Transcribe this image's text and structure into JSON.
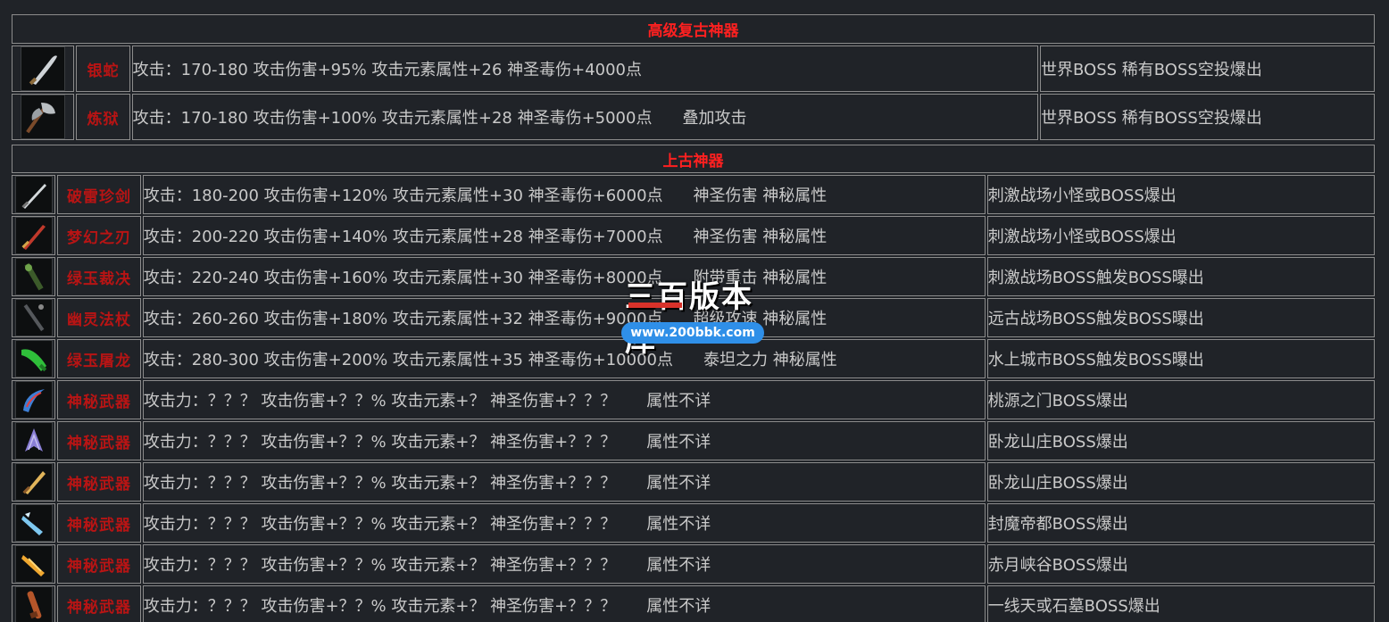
{
  "colors": {
    "background": "#202328",
    "section_title": "#ff2020",
    "item_name": "#b81414",
    "text": "#c9c9c9",
    "cell_border": "#8c8c8c"
  },
  "sections": [
    {
      "title": "高级复古神器",
      "rows": [
        {
          "icon": "curved-blade-icon",
          "name": "银蛇",
          "stats": "攻击：170-180 攻击伤害+95% 攻击元素属性+26 神圣毒伤+4000点",
          "extra": "",
          "source": "世界BOSS 稀有BOSS空投爆出"
        },
        {
          "icon": "battle-axe-icon",
          "name": "炼狱",
          "stats": "攻击：170-180 攻击伤害+100% 攻击元素属性+28 神圣毒伤+5000点",
          "extra": "叠加攻击",
          "source": "世界BOSS 稀有BOSS空投爆出"
        }
      ]
    },
    {
      "title": "上古神器",
      "rows": [
        {
          "icon": "silver-sword-icon",
          "name": "破雷珍剑",
          "stats": "攻击：180-200 攻击伤害+120% 攻击元素属性+30 神圣毒伤+6000点",
          "extra": "神圣伤害  神秘属性",
          "source": "刺激战场小怪或BOSS爆出"
        },
        {
          "icon": "red-sword-icon",
          "name": "梦幻之刃",
          "stats": "攻击：200-220 攻击伤害+140% 攻击元素属性+28 神圣毒伤+7000点",
          "extra": "神圣伤害  神秘属性",
          "source": "刺激战场小怪或BOSS爆出"
        },
        {
          "icon": "jade-staff-icon",
          "name": "绿玉裁决",
          "stats": "攻击：220-240 攻击伤害+160% 攻击元素属性+30 神圣毒伤+8000点",
          "extra": "附带重击  神秘属性",
          "source": "刺激战场BOSS触发BOSS曝出"
        },
        {
          "icon": "dark-staff-icon",
          "name": "幽灵法杖",
          "stats": "攻击：260-260 攻击伤害+180% 攻击元素属性+32 神圣毒伤+9000点",
          "extra": "超级攻速  神秘属性",
          "source": "远古战场BOSS触发BOSS曝出"
        },
        {
          "icon": "jade-dragon-icon",
          "name": "绿玉屠龙",
          "stats": "攻击：280-300 攻击伤害+200% 攻击元素属性+35 神圣毒伤+10000点",
          "extra": "泰坦之力  神秘属性",
          "source": "水上城市BOSS触发BOSS曝出"
        },
        {
          "icon": "hook-blade-icon",
          "name": "神秘武器",
          "stats": "攻击力：？？？ 攻击伤害+？？% 攻击元素+？ 神圣伤害+？？？",
          "extra": "属性不详",
          "source": "桃源之门BOSS爆出"
        },
        {
          "icon": "crystal-blade-icon",
          "name": "神秘武器",
          "stats": "攻击力：？？？ 攻击伤害+？？% 攻击元素+？ 神圣伤害+？？？",
          "extra": "属性不详",
          "source": "卧龙山庄BOSS爆出"
        },
        {
          "icon": "golden-sword-icon",
          "name": "神秘武器",
          "stats": "攻击力：？？？ 攻击伤害+？？% 攻击元素+？ 神圣伤害+？？？",
          "extra": "属性不详",
          "source": "卧龙山庄BOSS爆出"
        },
        {
          "icon": "ice-blade-icon",
          "name": "神秘武器",
          "stats": "攻击力：？？？ 攻击伤害+？？% 攻击元素+？ 神圣伤害+？？？",
          "extra": "属性不详",
          "source": "封魔帝都BOSS爆出"
        },
        {
          "icon": "flame-sword-icon",
          "name": "神秘武器",
          "stats": "攻击力：？？？ 攻击伤害+？？% 攻击元素+？ 神圣伤害+？？？",
          "extra": "属性不详",
          "source": "赤月峡谷BOSS爆出"
        },
        {
          "icon": "bronze-club-icon",
          "name": "神秘武器",
          "stats": "攻击力：？？？ 攻击伤害+？？% 攻击元素+？ 神圣伤害+？？？",
          "extra": "属性不详",
          "source": "一线天或石墓BOSS爆出"
        }
      ]
    }
  ],
  "watermark": {
    "title": "三百版本库",
    "url": "www.200bbk.com"
  }
}
